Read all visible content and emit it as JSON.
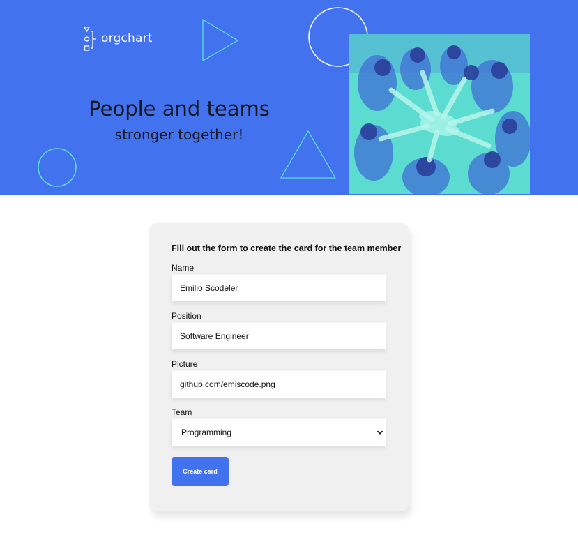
{
  "header": {
    "logo_text": "orgchart",
    "title": "People and teams",
    "subtitle": "stronger together!",
    "logo_icon": "orgchart-logo-icon",
    "photo": "team-hands-together-photo",
    "colors": {
      "banner_bg": "#4372ef",
      "accent_outline": "#5ce0d2",
      "photo_tint": "#5cdcd0"
    }
  },
  "form": {
    "heading": "Fill out the form to create the card for the team member",
    "fields": [
      {
        "label": "Name",
        "value": "Emilio Scodeler"
      },
      {
        "label": "Position",
        "value": "Software Engineer"
      },
      {
        "label": "Picture",
        "value": "github.com/emiscode.png"
      }
    ],
    "team": {
      "label": "Team",
      "selected": "Programming",
      "icon": "chevron-down-icon"
    },
    "submit_label": "Create card",
    "colors": {
      "card_bg": "#f0f0f0",
      "button_bg": "#4372ef"
    }
  }
}
